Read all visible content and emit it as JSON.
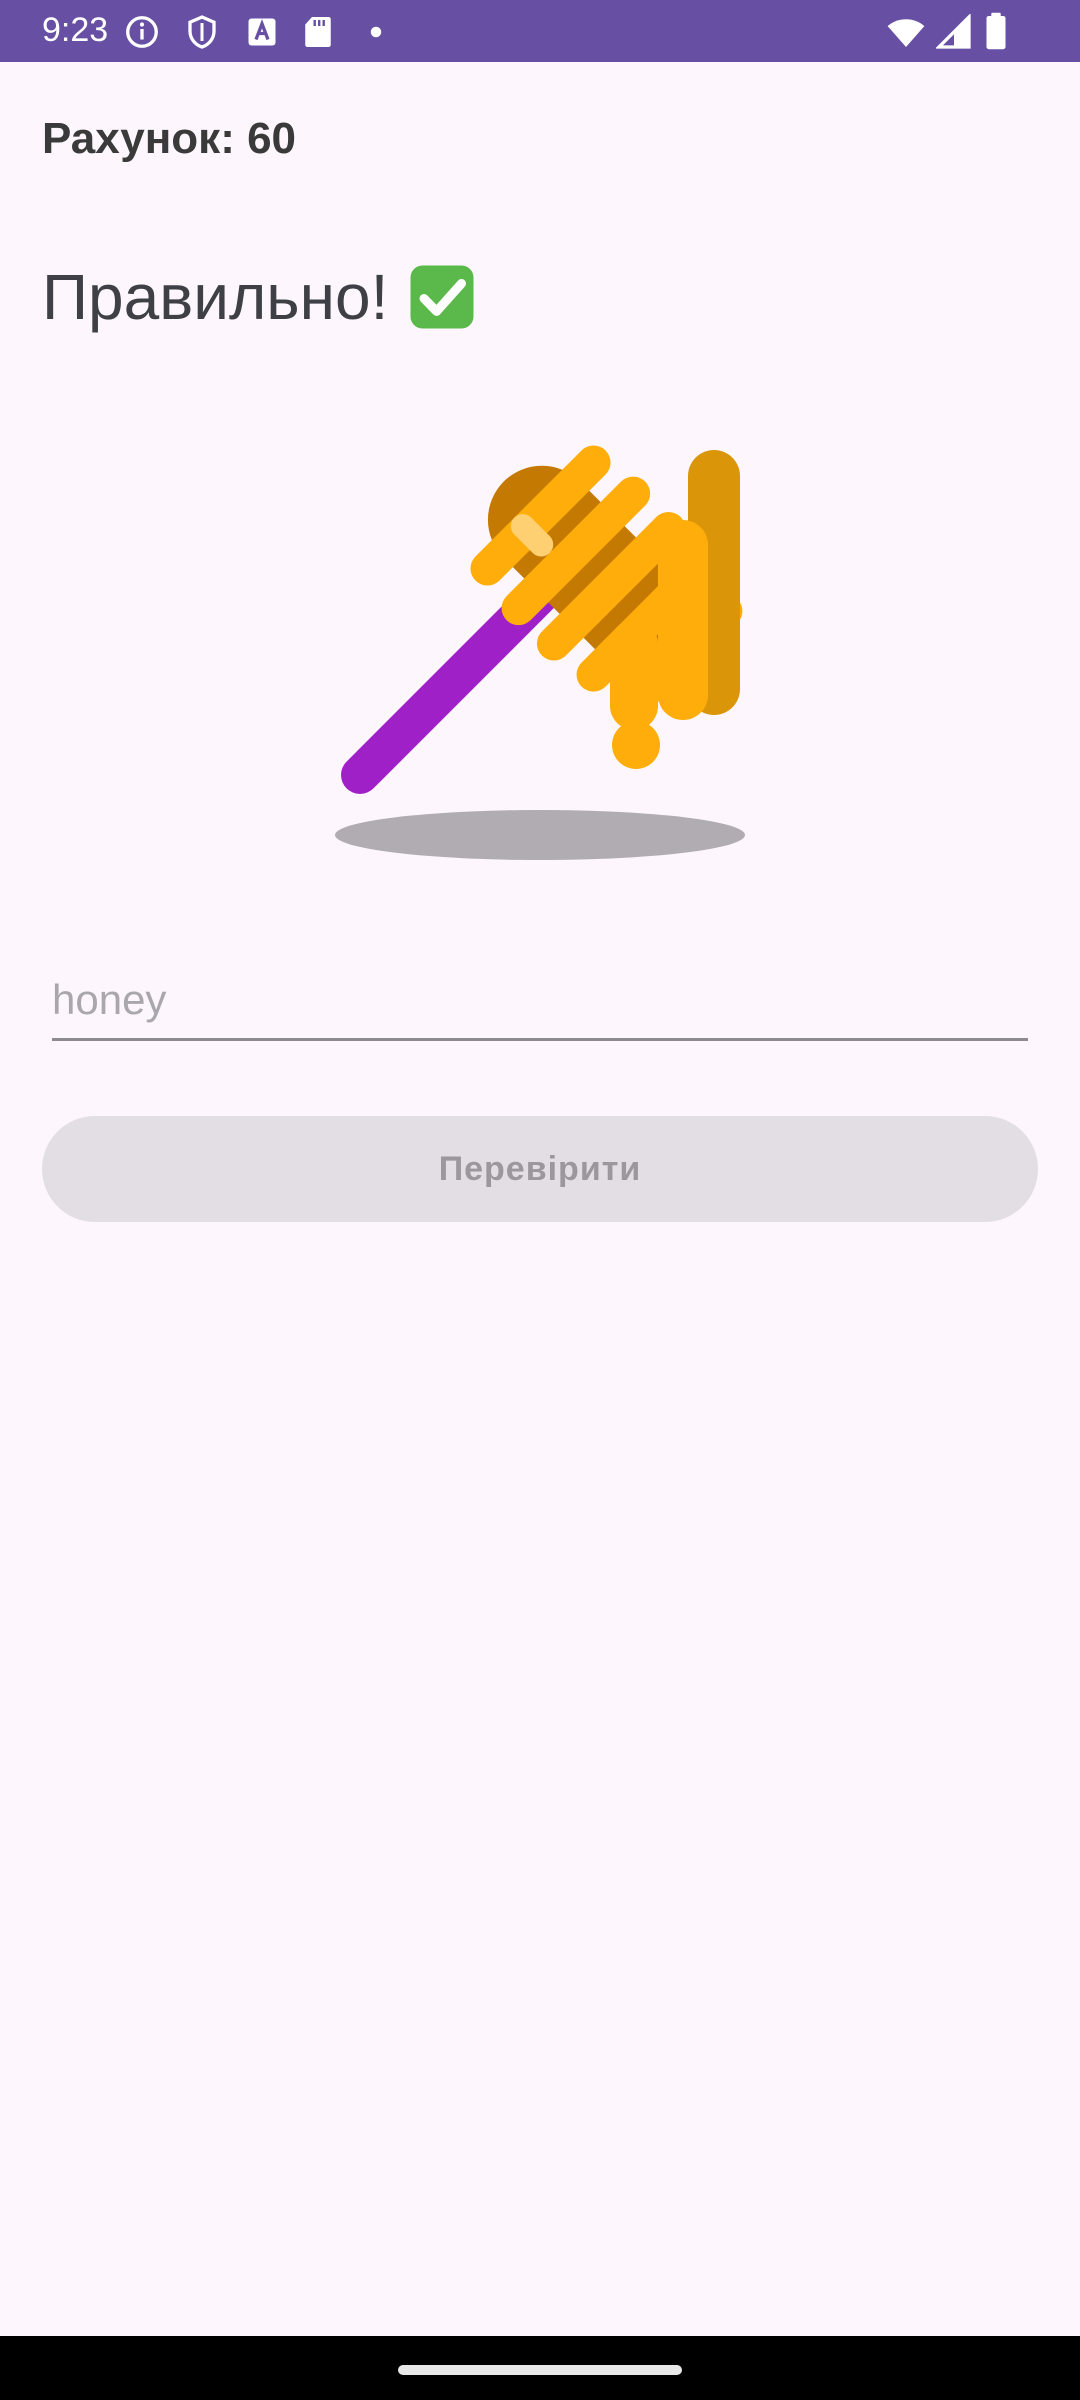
{
  "status_bar": {
    "time": "9:23",
    "background": "#6750a4",
    "icons_left": [
      "info-icon",
      "shield-icon",
      "font-icon",
      "sd-card-icon",
      "dot-icon"
    ],
    "icons_right": [
      "wifi-icon",
      "signal-icon",
      "battery-icon"
    ]
  },
  "game": {
    "score_text": "Рахунок: 60",
    "feedback_text": "Правильно!",
    "feedback_icon": "check-mark-icon",
    "image_icon": "honey-dipper-icon",
    "answer": {
      "value": "",
      "placeholder": "honey"
    },
    "check_button_label": "Перевірити"
  },
  "colors": {
    "accent": "#6750a4",
    "background": "#fdf7fd",
    "button_disabled": "#e3dee3",
    "success": "#5bb84a"
  }
}
